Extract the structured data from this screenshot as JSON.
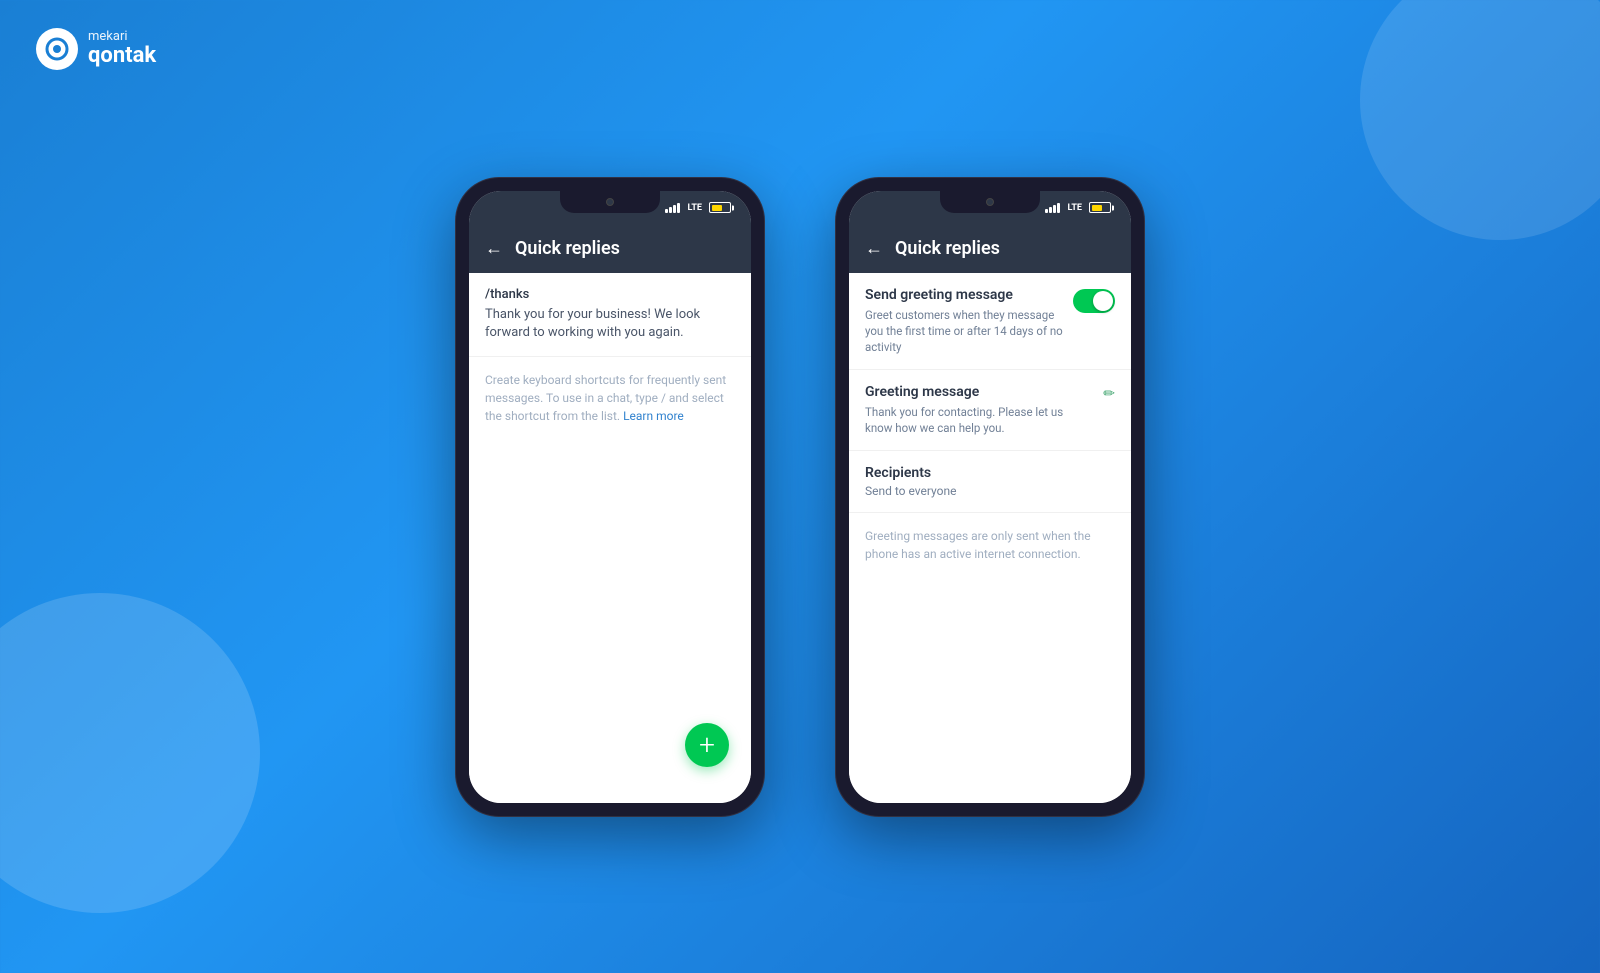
{
  "logo": {
    "mekari_label": "mekari",
    "qontak_label": "qontak"
  },
  "phone1": {
    "header": {
      "title": "Quick replies",
      "back_label": "←"
    },
    "reply_item": {
      "shortcut": "/thanks",
      "text": "Thank you for your business! We look forward to working with you again."
    },
    "hint": {
      "text": "Create keyboard shortcuts for frequently sent messages. To use in a chat, type / and select the shortcut from the list.",
      "learn_more": "Learn more"
    },
    "fab_label": "+"
  },
  "phone2": {
    "header": {
      "title": "Quick replies",
      "back_label": "←"
    },
    "send_greeting": {
      "label": "Send greeting message",
      "sublabel": "Greet customers when they message you the first time or after 14 days of no activity",
      "toggle_on": true
    },
    "greeting_message": {
      "label": "Greeting message",
      "text": "Thank you for contacting. Please let us know how we can help you.",
      "edit_icon": "✏"
    },
    "recipients": {
      "label": "Recipients",
      "value": "Send to everyone"
    },
    "info_text": "Greeting messages are only sent when the phone has an active internet connection."
  }
}
